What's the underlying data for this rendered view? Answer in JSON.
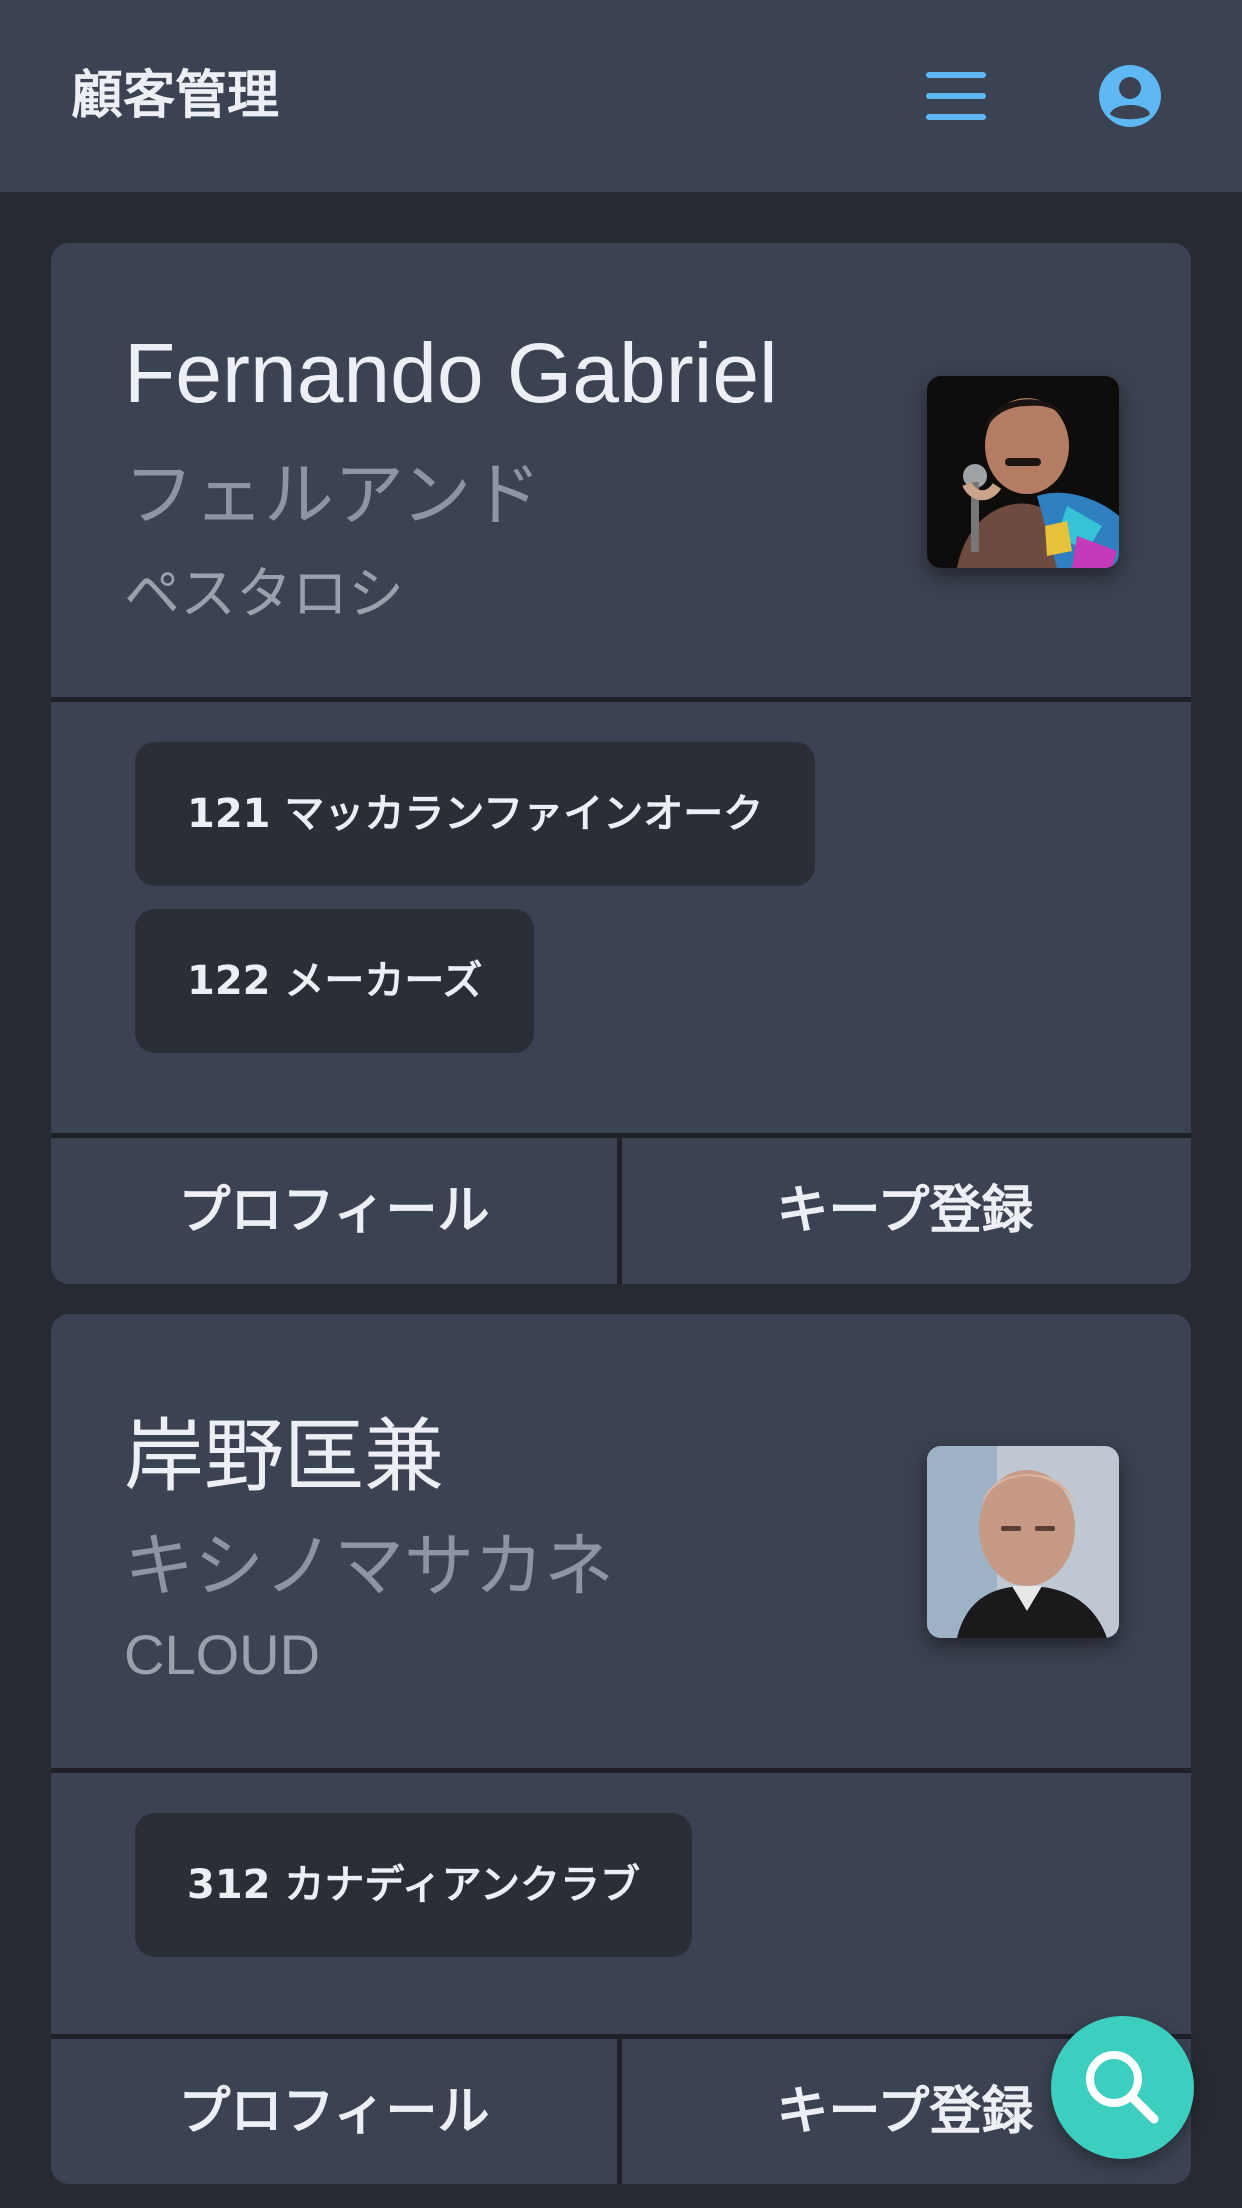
{
  "header": {
    "title": "顧客管理",
    "menu_icon": "hamburger-menu-icon",
    "account_icon": "user-circle-icon",
    "accent_color": "#5eb8f3"
  },
  "customers": [
    {
      "name": "Fernando Gabriel",
      "kana": "フェルアンド",
      "sub": "ペスタロシ",
      "photo": "man-singing-into-microphone",
      "tags": [
        "121 マッカランファインオーク",
        "122 メーカーズ"
      ],
      "actions": {
        "profile": "プロフィール",
        "keep": "キープ登録"
      }
    },
    {
      "name": "岸野匡兼",
      "kana": "キシノマサカネ",
      "sub": "CLOUD",
      "photo": "bald-man-portrait",
      "tags": [
        "312 カナディアンクラブ"
      ],
      "actions": {
        "profile": "プロフィール",
        "keep": "キープ登録"
      }
    }
  ],
  "fab": {
    "icon": "search-icon",
    "color": "#3ccfbf"
  }
}
